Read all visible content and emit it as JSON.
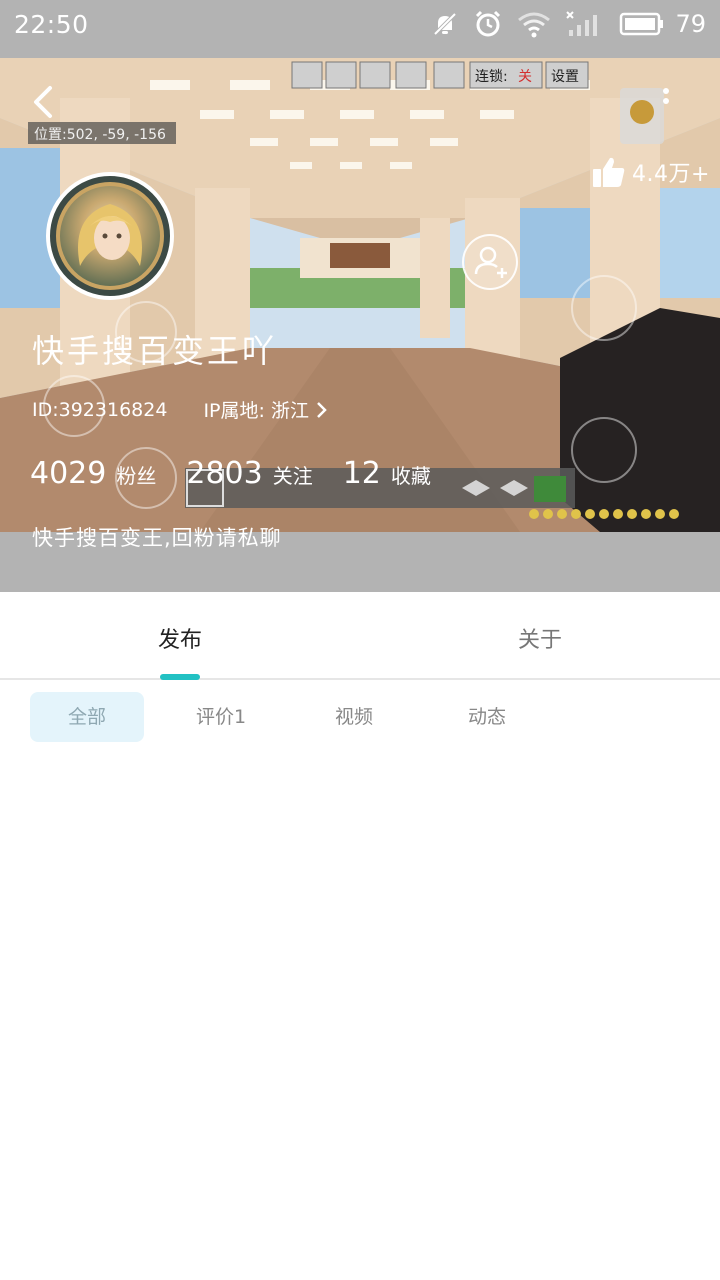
{
  "status_bar": {
    "time": "22:50",
    "battery": "79"
  },
  "profile": {
    "likes": "4.4万+",
    "username": "快手搜百变王吖",
    "id_text": "ID:392316824",
    "ip_label": "IP属地: 浙江",
    "stats": [
      {
        "number": "4029",
        "label": "粉丝"
      },
      {
        "number": "2803",
        "label": "关注"
      },
      {
        "number": "12",
        "label": "收藏"
      }
    ],
    "bio": "快手搜百变王,回粉请私聊"
  },
  "game_overlay": {
    "position": "位置:502, -59, -156",
    "chain": "连锁:",
    "chain_state": "关",
    "settings": "设置"
  },
  "tabs": [
    {
      "label": "发布",
      "active": true
    },
    {
      "label": "关于",
      "active": false
    }
  ],
  "filters": [
    {
      "label": "全部",
      "active": true
    },
    {
      "label": "评价1",
      "active": false
    },
    {
      "label": "视频",
      "active": false
    },
    {
      "label": "动态",
      "active": false
    }
  ],
  "colors": {
    "accent": "#22c1c3",
    "status_bar_bg": "#b3b3b3",
    "chip_active_bg": "#e4f4fb"
  }
}
